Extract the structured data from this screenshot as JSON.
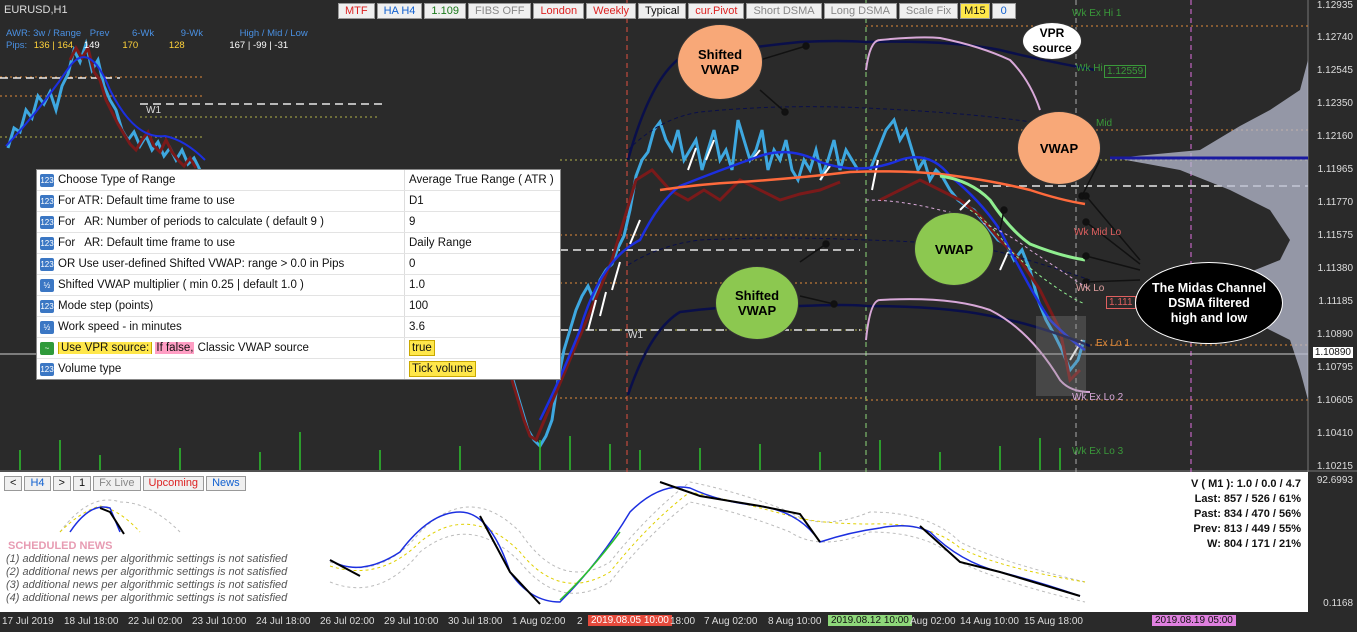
{
  "symbol": "EURUSD,H1",
  "topbar": [
    {
      "label": "MTF",
      "style": "red"
    },
    {
      "label": "HA H4",
      "style": "blue"
    },
    {
      "label": "1.109",
      "style": "green"
    },
    {
      "label": "FIBS OFF",
      "style": "grey"
    },
    {
      "label": "London",
      "style": "red"
    },
    {
      "label": "Weekly",
      "style": "red"
    },
    {
      "label": "Typical",
      "style": ""
    },
    {
      "label": "cur.Pivot",
      "style": "red"
    },
    {
      "label": "Short DSMA",
      "style": "grey"
    },
    {
      "label": "Long DSMA",
      "style": "grey"
    },
    {
      "label": "Scale Fix",
      "style": "grey"
    },
    {
      "label": "M15",
      "style": "yellow"
    },
    {
      "label": "0",
      "style": "blue"
    }
  ],
  "awr": {
    "row1": [
      "AWR: 3w / Range",
      "Prev",
      "6-Wk",
      "9-Wk",
      "High / Mid / Low"
    ],
    "row2_label": "Pips:",
    "row2_values": [
      "136 | 164",
      "149",
      "170",
      "128",
      "167 | -99 | -31"
    ]
  },
  "price_axis": [
    "1.12935",
    "1.12740",
    "1.12545",
    "1.12350",
    "1.12160",
    "1.11965",
    "1.11770",
    "1.11575",
    "1.11380",
    "1.11185",
    "1.10890",
    "1.10795",
    "1.10605",
    "1.10410",
    "1.10215"
  ],
  "current_price": "1.10890",
  "level_labels": {
    "wk_ex_hi_1": "Wk Ex Hi 1",
    "wk_hi": "Wk Hi",
    "wk_hi_value": "1.12559",
    "mid": "Mid",
    "wk_mid_lo": "Wk Mid Lo",
    "wk_lo": "Wk Lo",
    "wk_lo_value": "1.111",
    "ex_lo_1": "Ex Lo 1",
    "wk_ex_lo_2": "Wk Ex Lo 2",
    "wk_ex_lo_3": "Wk Ex Lo 3",
    "w1_a": "W1",
    "w1_b": "W1"
  },
  "bubbles": {
    "shifted_vwap_top": "Shifted\nVWAP",
    "vpr_source": "VPR\nsource",
    "vwap_right": "VWAP",
    "vwap_mid": "VWAP",
    "shifted_vwap_bottom": "Shifted\nVWAP",
    "midas": "The Midas Channel\nDSMA filtered\nhigh and low"
  },
  "params": [
    {
      "name": "Choose Type of Range",
      "value": "Average True Range ( ATR )",
      "icon": "123",
      "icon_name": "integer-param-icon"
    },
    {
      "name": "For ATR: Default time frame to use",
      "value": "D1",
      "icon": "123",
      "icon_name": "integer-param-icon"
    },
    {
      "name": "For   AR: Number of periods to calculate ( default 9 )",
      "value": "9",
      "icon": "123",
      "icon_name": "integer-param-icon"
    },
    {
      "name": "For   AR: Default time frame to use",
      "value": "Daily Range",
      "icon": "123",
      "icon_name": "integer-param-icon"
    },
    {
      "name": "OR Use user-defined Shifted VWAP: range > 0.0 in Pips",
      "value": "0",
      "icon": "123",
      "icon_name": "integer-param-icon"
    },
    {
      "name": "Shifted VWAP multiplier ( min 0.25 | default 1.0 )",
      "value": "1.0",
      "icon": "½",
      "icon_name": "double-param-icon"
    },
    {
      "name": "Mode step (points)",
      "value": "100",
      "icon": "123",
      "icon_name": "integer-param-icon"
    },
    {
      "name": "Work speed - in minutes",
      "value": "3.6",
      "icon": "½",
      "icon_name": "double-param-icon"
    },
    {
      "name": "Use VPR source:",
      "name_suffix_pink": "If false,",
      "name_suffix": " Classic VWAP source",
      "value": "true",
      "icon": "~",
      "icon_name": "bool-param-icon",
      "highlight": true
    },
    {
      "name": "Volume type",
      "value": "Tick volume",
      "icon": "123",
      "icon_name": "integer-param-icon",
      "highlight_value": true
    }
  ],
  "subbar": [
    {
      "label": "<",
      "style": ""
    },
    {
      "label": "H4",
      "style": "blue"
    },
    {
      "label": ">",
      "style": ""
    },
    {
      "label": "1",
      "style": ""
    },
    {
      "label": "Fx Live",
      "style": "grey"
    },
    {
      "label": "Upcoming",
      "style": "red"
    },
    {
      "label": "News",
      "style": "blue"
    }
  ],
  "news": {
    "title": "SCHEDULED NEWS",
    "lines": [
      "(1) additional news per algorithmic settings is not satisfied",
      "(2) additional news per algorithmic settings is not satisfied",
      "(3) additional news per algorithmic settings is not satisfied",
      "(4) additional news per algorithmic settings is not satisfied"
    ]
  },
  "stats": [
    "V ( M1 ): 1.0 / 0.0 / 4.7",
    "Last: 857 / 526 / 61%",
    "Past: 834 / 470 / 56%",
    "Prev: 813 / 449 / 55%",
    "W: 804 / 171 / 21%"
  ],
  "sub_axis": [
    "92.6993",
    "0.1168"
  ],
  "time_axis": [
    {
      "label": "17 Jul 2019",
      "style": ""
    },
    {
      "label": "18 Jul 18:00",
      "style": ""
    },
    {
      "label": "22 Jul 02:00",
      "style": ""
    },
    {
      "label": "23 Jul 10:00",
      "style": ""
    },
    {
      "label": "24 Jul 18:00",
      "style": ""
    },
    {
      "label": "26 Jul 02:00",
      "style": ""
    },
    {
      "label": "29 Jul 10:00",
      "style": ""
    },
    {
      "label": "30 Jul 18:00",
      "style": ""
    },
    {
      "label": "1 Aug 02:00",
      "style": ""
    },
    {
      "label": "2",
      "style": ""
    },
    {
      "label": "2019.08.05 10:00",
      "style": "redbox"
    },
    {
      "label": "18:00",
      "style": ""
    },
    {
      "label": "7 Aug 02:00",
      "style": ""
    },
    {
      "label": "8 Aug 10:00",
      "style": ""
    },
    {
      "label": "2019.08.12 10:00",
      "style": "greenbox"
    },
    {
      "label": "Aug 02:00",
      "style": ""
    },
    {
      "label": "14 Aug 10:00",
      "style": ""
    },
    {
      "label": "15 Aug 18:00",
      "style": ""
    },
    {
      "label": "2019.08.19 05:00",
      "style": "pinkbox"
    }
  ],
  "colors": {
    "background": "#2a2a2a",
    "vwap_blue": "#1c2fe0",
    "shifted_vwap_navy": "#0a0f4a",
    "channel_pink": "#d8a8d8",
    "vwap_orange": "#ff6a3c",
    "midas_green": "#90ee90",
    "bar_blue": "#3ea8e0",
    "bar_red": "#7a1a1a"
  }
}
